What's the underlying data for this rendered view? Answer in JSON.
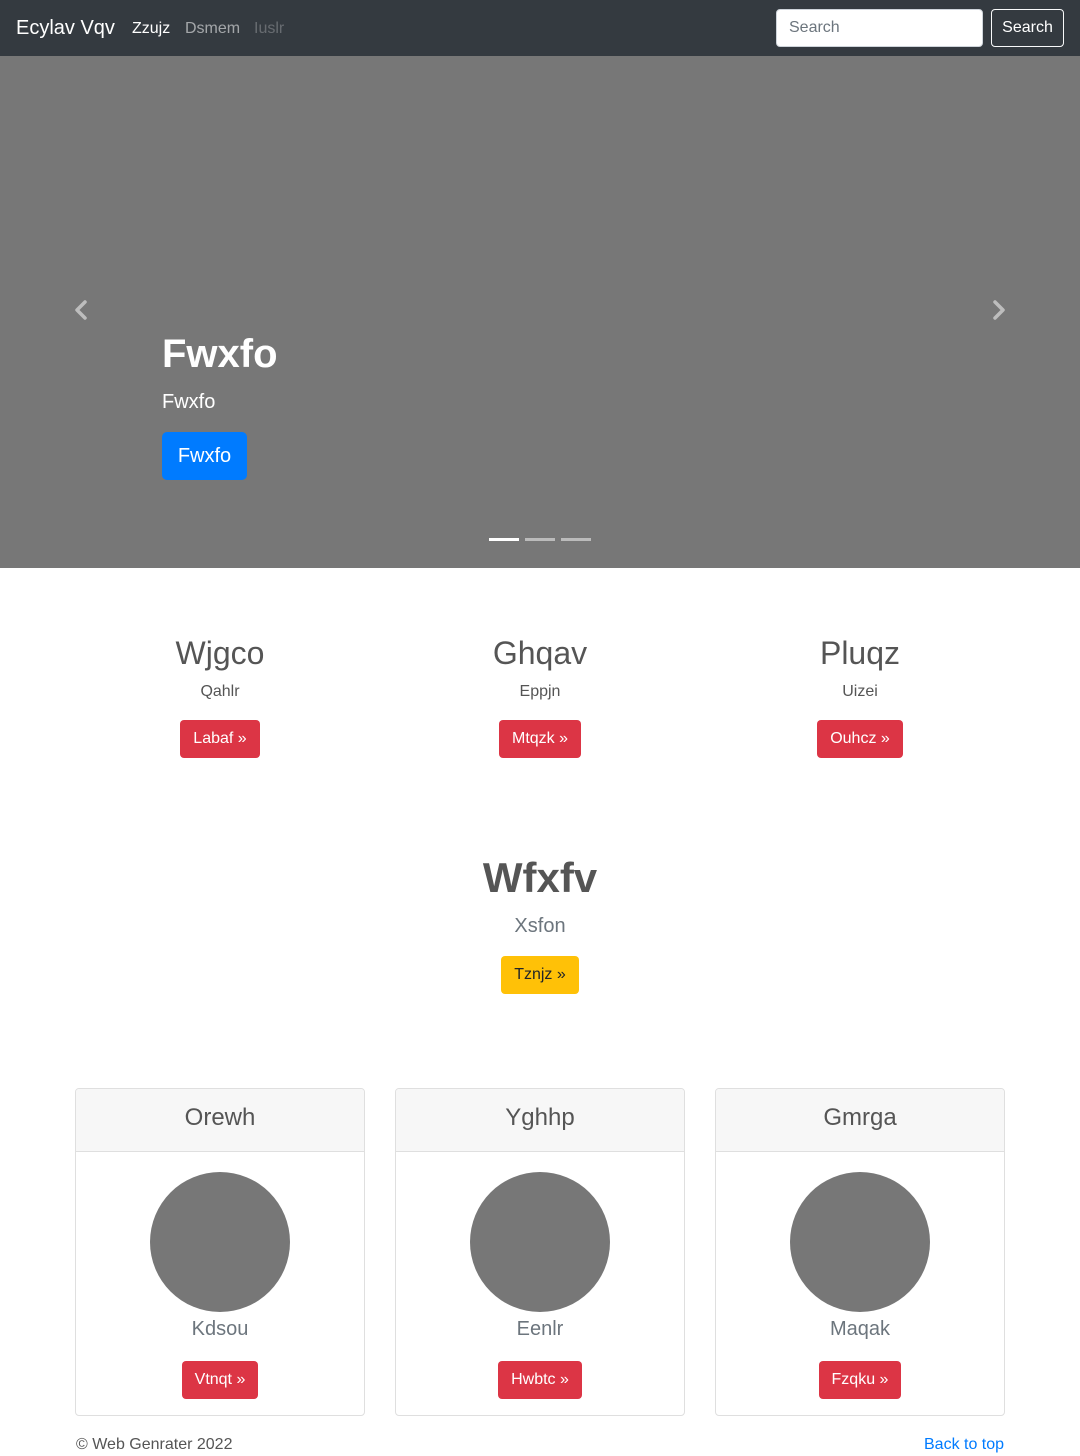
{
  "navbar": {
    "brand": "Ecylav Vqv",
    "links": [
      {
        "label": "Zzujz",
        "state": "active"
      },
      {
        "label": "Dsmem",
        "state": "normal"
      },
      {
        "label": "Iuslr",
        "state": "disabled"
      }
    ],
    "search_placeholder": "Search",
    "search_button": "Search"
  },
  "carousel": {
    "title": "Fwxfo",
    "subtitle": "Fwxfo",
    "button": "Fwxfo",
    "slide_count": 3,
    "active_slide": 1,
    "prev_icon": "chevron-left-icon",
    "next_icon": "chevron-right-icon"
  },
  "features": [
    {
      "title": "Wjgco",
      "text": "Qahlr",
      "button": "Labaf »"
    },
    {
      "title": "Ghqav",
      "text": "Eppjn",
      "button": "Mtqzk »"
    },
    {
      "title": "Pluqz",
      "text": "Uizei",
      "button": "Ouhcz »"
    }
  ],
  "hero": {
    "title": "Wfxfv",
    "lead": "Xsfon",
    "button": "Tznjz »"
  },
  "cards": [
    {
      "header": "Orewh",
      "text": "Kdsou",
      "button": "Vtnqt »"
    },
    {
      "header": "Yghhp",
      "text": "Eenlr",
      "button": "Hwbtc »"
    },
    {
      "header": "Gmrga",
      "text": "Maqak",
      "button": "Fzqku »"
    }
  ],
  "footer": {
    "copyright": "© Web Genrater 2022",
    "back_to_top": "Back to top"
  },
  "colors": {
    "navbar_bg": "#343a40",
    "carousel_bg": "#777777",
    "primary": "#007bff",
    "danger": "#dc3545",
    "warning": "#ffc107"
  }
}
